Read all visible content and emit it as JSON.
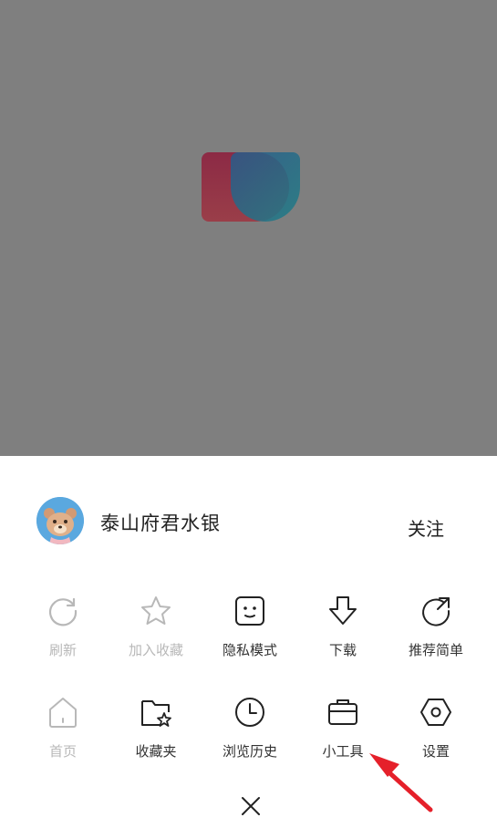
{
  "app": {
    "user": {
      "name": "泰山府君水银",
      "follow_label": "关注"
    },
    "menu_row1": [
      {
        "label": "刷新",
        "enabled": false,
        "icon": "refresh-icon"
      },
      {
        "label": "加入收藏",
        "enabled": false,
        "icon": "star-icon"
      },
      {
        "label": "隐私模式",
        "enabled": true,
        "icon": "privacy-face-icon"
      },
      {
        "label": "下载",
        "enabled": true,
        "icon": "download-arrow-icon"
      },
      {
        "label": "推荐简单",
        "enabled": true,
        "icon": "share-arrow-icon"
      }
    ],
    "menu_row2": [
      {
        "label": "首页",
        "enabled": false,
        "icon": "home-icon"
      },
      {
        "label": "收藏夹",
        "enabled": true,
        "icon": "bookmark-folder-icon"
      },
      {
        "label": "浏览历史",
        "enabled": true,
        "icon": "clock-icon"
      },
      {
        "label": "小工具",
        "enabled": true,
        "icon": "toolbox-icon"
      },
      {
        "label": "设置",
        "enabled": true,
        "icon": "settings-hexagon-icon"
      }
    ],
    "colors": {
      "overlay": "#7f7f7f",
      "annotation_arrow": "#e5202a",
      "disabled_text": "#b8b8b8",
      "enabled_text": "#333333"
    }
  }
}
